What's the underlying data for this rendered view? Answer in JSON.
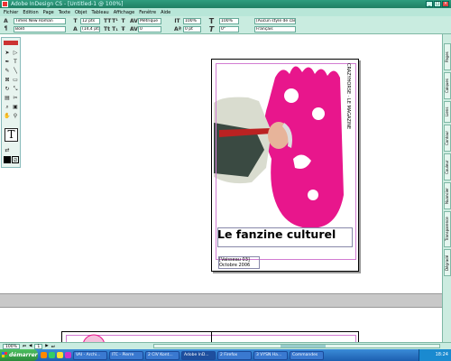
{
  "window": {
    "title": "Adobe InDesign CS - [Untitled-1 @ 100%]"
  },
  "menu": [
    "Fichier",
    "Edition",
    "Page",
    "Texte",
    "Objet",
    "Tableau",
    "Affichage",
    "Fenêtre",
    "Aide"
  ],
  "control": {
    "font_family": "Times New Roman",
    "font_style": "Bold",
    "font_size": "12 pts",
    "leading": "(14,4 pt)",
    "kerning": "Métrique",
    "tracking": "0",
    "h_scale": "100%",
    "v_scale": "100%",
    "baseline": "0 pt",
    "skew": "0°",
    "char_style": "[Aucun style de caractère]",
    "language": "Français"
  },
  "document": {
    "headline": "Le fanzine culturel",
    "sub_line1": "[Vaisseau 03]",
    "sub_line2": "Octobre 2006",
    "side_text": "CRAZYHORSE · LE MAGAZINE"
  },
  "colors": {
    "accent": "#e8168c",
    "ui_green": "#c9ece0",
    "title_bar": "#2a8c6e"
  },
  "right_panel": [
    "Pages",
    "Calques",
    "Liens",
    "Contour",
    "Couleur",
    "Nuancier",
    "Transparence",
    "Dégradé"
  ],
  "status": {
    "zoom": "100%",
    "page": "1"
  },
  "taskbar": {
    "start": "démarrer",
    "tasks": [
      "VAI - Archi...",
      "ITC - Pierre",
      "2 CIV Kont...",
      "Adobe InD...",
      "2 Firefox",
      "3 VYSN Ha...",
      "Commandes"
    ],
    "clock": "18:24"
  }
}
